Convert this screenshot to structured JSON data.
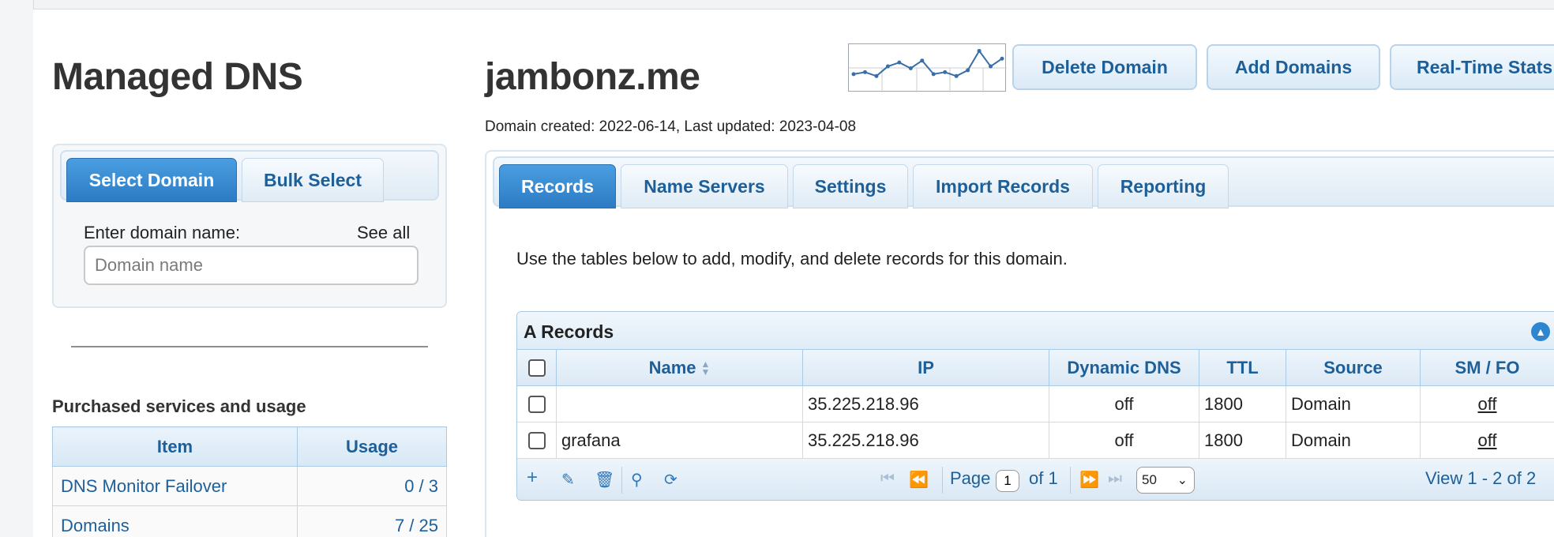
{
  "left": {
    "title": "Managed DNS",
    "tabs": [
      {
        "label": "Select Domain",
        "active": true
      },
      {
        "label": "Bulk Select",
        "active": false
      }
    ],
    "domain_label": "Enter domain name:",
    "see_all": "See all",
    "domain_placeholder": "Domain name",
    "services_title": "Purchased services and usage",
    "services_headers": [
      "Item",
      "Usage"
    ],
    "services": [
      {
        "item": "DNS Monitor Failover",
        "usage": "0 / 3"
      },
      {
        "item": "Domains",
        "usage": "7 / 25"
      }
    ]
  },
  "domain": {
    "name": "jambonz.me",
    "meta": "Domain created: 2022-06-14, Last updated: 2023-04-08",
    "buttons": [
      "Delete Domain",
      "Add Domains",
      "Real-Time Stats"
    ],
    "sparkline": [
      0.35,
      0.4,
      0.3,
      0.55,
      0.65,
      0.5,
      0.7,
      0.35,
      0.4,
      0.3,
      0.45,
      0.95,
      0.55,
      0.75
    ]
  },
  "tabs": [
    {
      "label": "Records",
      "active": true
    },
    {
      "label": "Name Servers",
      "active": false
    },
    {
      "label": "Settings",
      "active": false
    },
    {
      "label": "Import Records",
      "active": false
    },
    {
      "label": "Reporting",
      "active": false
    }
  ],
  "intro": "Use the tables below to add, modify, and delete records for this domain.",
  "a_records": {
    "caption": "A Records",
    "headers": [
      "Name",
      "IP",
      "Dynamic DNS",
      "TTL",
      "Source",
      "SM / FO"
    ],
    "rows": [
      {
        "name": "",
        "ip": "35.225.218.96",
        "ddns": "off",
        "ttl": "1800",
        "source": "Domain",
        "smfo": "off"
      },
      {
        "name": "grafana",
        "ip": "35.225.218.96",
        "ddns": "off",
        "ttl": "1800",
        "source": "Domain",
        "smfo": "off"
      }
    ],
    "pager": {
      "page_label": "Page",
      "page": "1",
      "of_label": "of 1",
      "per_page": "50",
      "view": "View 1 - 2 of 2"
    }
  },
  "colors": {
    "accent": "#2c7bc4",
    "link": "#1d5f99"
  }
}
